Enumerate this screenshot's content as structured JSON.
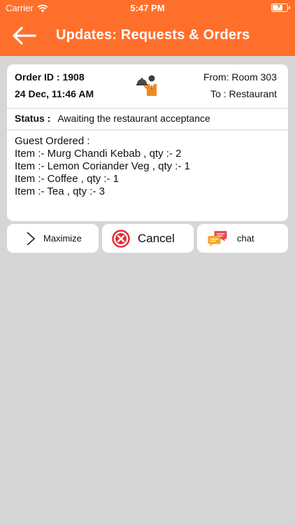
{
  "status_bar": {
    "carrier": "Carrier",
    "time": "5:47 PM"
  },
  "header": {
    "title": "Updates: Requests & Orders"
  },
  "order": {
    "order_id": "Order ID : 1908",
    "datetime": "24 Dec, 11:46 AM",
    "from": "From: Room 303",
    "to": "To : Restaurant",
    "status_label": "Status :",
    "status_value": "Awaiting the restaurant acceptance",
    "guest_ordered": "Guest Ordered :",
    "items": [
      "Item :- Murg Chandi Kebab , qty :- 2",
      "Item :- Lemon Coriander Veg , qty :- 1",
      "Item :- Coffee , qty :- 1",
      "Item :- Tea , qty :- 3"
    ]
  },
  "actions": {
    "maximize": "Maximize",
    "cancel": "Cancel",
    "chat": "chat"
  },
  "colors": {
    "brand": "#ff6f2c",
    "background": "#d6d6d6",
    "cancel_red": "#e0303a"
  }
}
